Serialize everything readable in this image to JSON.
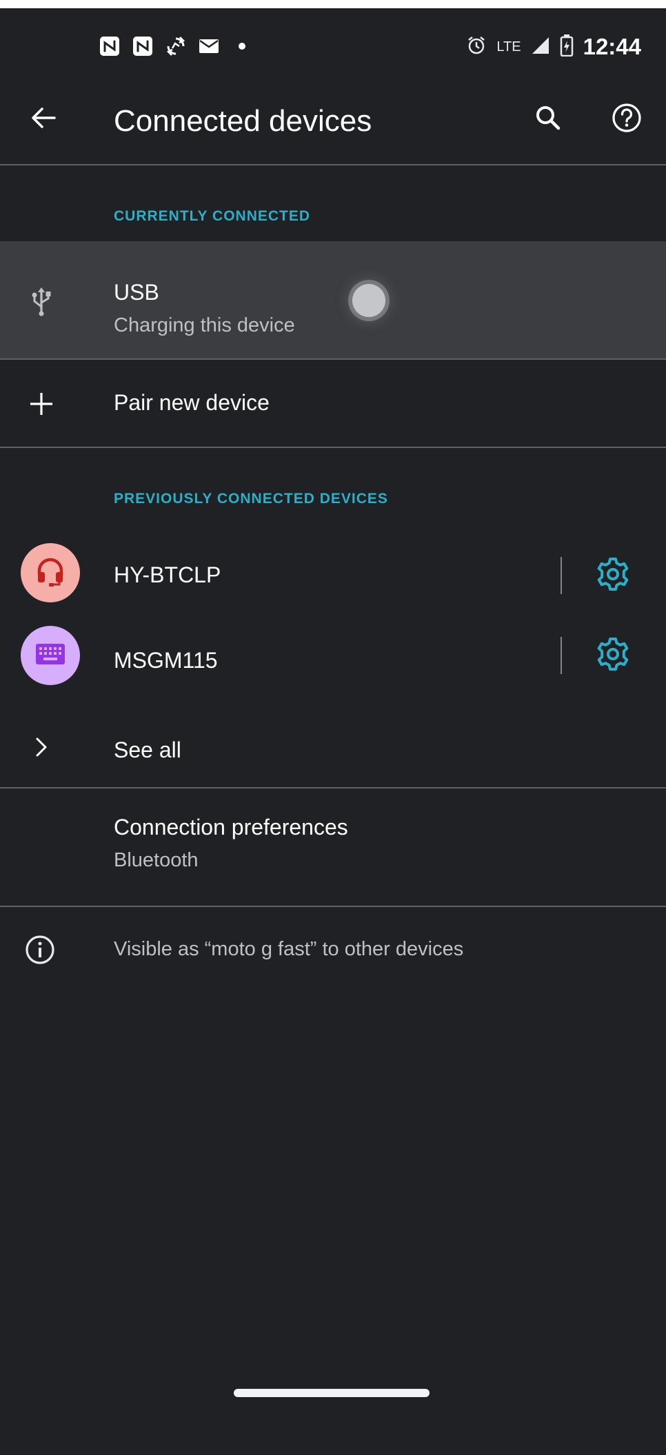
{
  "status_bar": {
    "network_label": "LTE",
    "time": "12:44",
    "notification_icons": [
      "nfc-icon",
      "nfc-icon",
      "sync-icon",
      "mail-icon",
      "dot-icon"
    ],
    "status_icons": [
      "alarm-icon",
      "signal-icon",
      "battery-charging-icon"
    ]
  },
  "app_bar": {
    "title": "Connected devices",
    "icons": [
      "back-arrow-icon",
      "search-icon",
      "help-icon"
    ]
  },
  "currently_connected": {
    "header": "CURRENTLY CONNECTED",
    "usb": {
      "title": "USB",
      "subtitle": "Charging this device",
      "icon": "usb-icon"
    }
  },
  "pair_new": {
    "label": "Pair new device",
    "icon": "plus-icon"
  },
  "previously_connected": {
    "header": "PREVIOUSLY CONNECTED DEVICES",
    "devices": [
      {
        "name": "HY-BTCLP",
        "icon": "headset-icon",
        "avatar_bg": "#f6aea9",
        "icon_color": "#c5221f"
      },
      {
        "name": "MSGM115",
        "icon": "keyboard-icon",
        "avatar_bg": "#d7aefb",
        "icon_color": "#9334e6"
      }
    ],
    "see_all": "See all"
  },
  "connection_preferences": {
    "title": "Connection preferences",
    "subtitle": "Bluetooth"
  },
  "footer": {
    "text": "Visible as “moto g fast” to other devices",
    "icon": "info-icon"
  },
  "colors": {
    "background": "#202124",
    "accent": "#2ab0c8",
    "highlight_row": "#3b3d41",
    "divider": "#5f6368"
  }
}
